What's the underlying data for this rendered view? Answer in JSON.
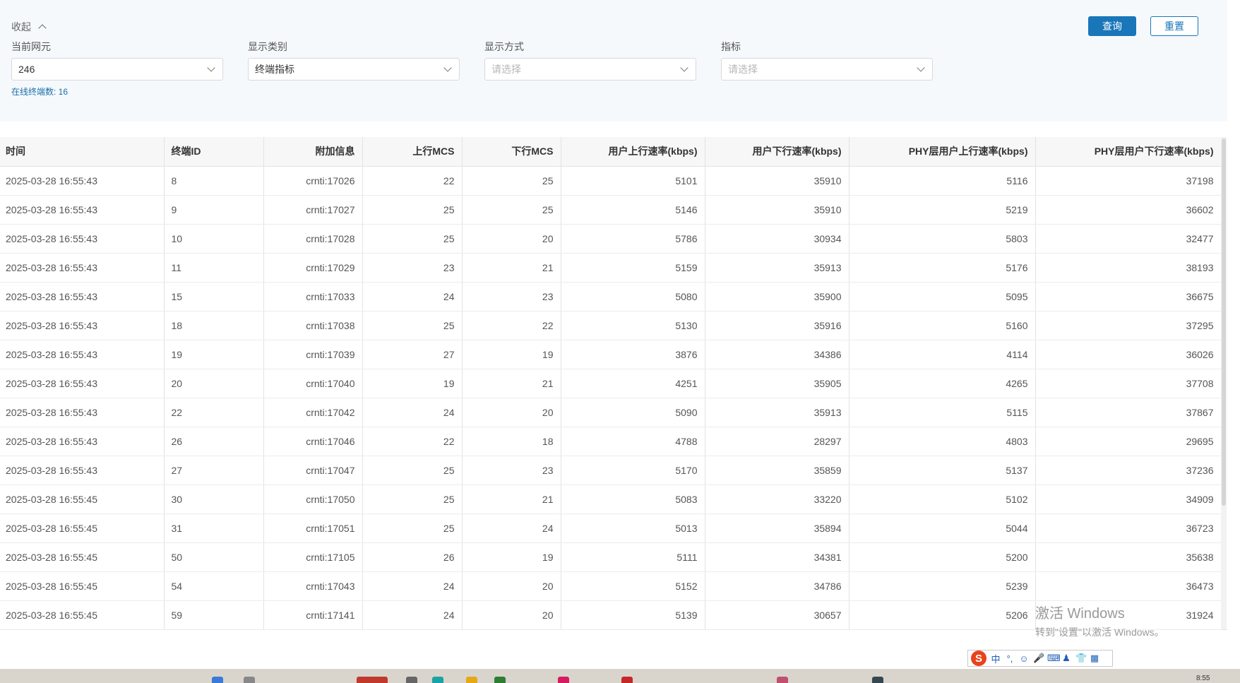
{
  "filters": {
    "collapse_label": "收起",
    "network_element": {
      "label": "当前网元",
      "value": "246"
    },
    "display_category": {
      "label": "显示类别",
      "value": "终端指标"
    },
    "display_mode": {
      "label": "显示方式",
      "placeholder": "请选择"
    },
    "indicator": {
      "label": "指标",
      "placeholder": "请选择"
    },
    "online_terminals": "在线终端数: 16",
    "query_label": "查询",
    "reset_label": "重置"
  },
  "table": {
    "headers": [
      "时间",
      "终端ID",
      "附加信息",
      "上行MCS",
      "下行MCS",
      "用户上行速率(kbps)",
      "用户下行速率(kbps)",
      "PHY层用户上行速率(kbps)",
      "PHY层用户下行速率(kbps)"
    ],
    "rows": [
      [
        "2025-03-28 16:55:43",
        "8",
        "crnti:17026",
        "22",
        "25",
        "5101",
        "35910",
        "5116",
        "37198"
      ],
      [
        "2025-03-28 16:55:43",
        "9",
        "crnti:17027",
        "25",
        "25",
        "5146",
        "35910",
        "5219",
        "36602"
      ],
      [
        "2025-03-28 16:55:43",
        "10",
        "crnti:17028",
        "25",
        "20",
        "5786",
        "30934",
        "5803",
        "32477"
      ],
      [
        "2025-03-28 16:55:43",
        "11",
        "crnti:17029",
        "23",
        "21",
        "5159",
        "35913",
        "5176",
        "38193"
      ],
      [
        "2025-03-28 16:55:43",
        "15",
        "crnti:17033",
        "24",
        "23",
        "5080",
        "35900",
        "5095",
        "36675"
      ],
      [
        "2025-03-28 16:55:43",
        "18",
        "crnti:17038",
        "25",
        "22",
        "5130",
        "35916",
        "5160",
        "37295"
      ],
      [
        "2025-03-28 16:55:43",
        "19",
        "crnti:17039",
        "27",
        "19",
        "3876",
        "34386",
        "4114",
        "36026"
      ],
      [
        "2025-03-28 16:55:43",
        "20",
        "crnti:17040",
        "19",
        "21",
        "4251",
        "35905",
        "4265",
        "37708"
      ],
      [
        "2025-03-28 16:55:43",
        "22",
        "crnti:17042",
        "24",
        "20",
        "5090",
        "35913",
        "5115",
        "37867"
      ],
      [
        "2025-03-28 16:55:43",
        "26",
        "crnti:17046",
        "22",
        "18",
        "4788",
        "28297",
        "4803",
        "29695"
      ],
      [
        "2025-03-28 16:55:43",
        "27",
        "crnti:17047",
        "25",
        "23",
        "5170",
        "35859",
        "5137",
        "37236"
      ],
      [
        "2025-03-28 16:55:45",
        "30",
        "crnti:17050",
        "25",
        "21",
        "5083",
        "33220",
        "5102",
        "34909"
      ],
      [
        "2025-03-28 16:55:45",
        "31",
        "crnti:17051",
        "25",
        "24",
        "5013",
        "35894",
        "5044",
        "36723"
      ],
      [
        "2025-03-28 16:55:45",
        "50",
        "crnti:17105",
        "26",
        "19",
        "5111",
        "34381",
        "5200",
        "35638"
      ],
      [
        "2025-03-28 16:55:45",
        "54",
        "crnti:17043",
        "24",
        "20",
        "5152",
        "34786",
        "5239",
        "36473"
      ],
      [
        "2025-03-28 16:55:45",
        "59",
        "crnti:17141",
        "24",
        "20",
        "5139",
        "30657",
        "5206",
        "31924"
      ]
    ]
  },
  "watermark": {
    "line1": "激活 Windows",
    "line2": "转到\"设置\"以激活 Windows。"
  },
  "ime": {
    "logo": "S",
    "mode": "中",
    "punct": "°,"
  },
  "taskbar": {
    "time": "8:55"
  },
  "colors": {
    "primary": "#1976b8",
    "panel_bg": "#f5f9fc",
    "header_bg": "#f7f7f7"
  }
}
